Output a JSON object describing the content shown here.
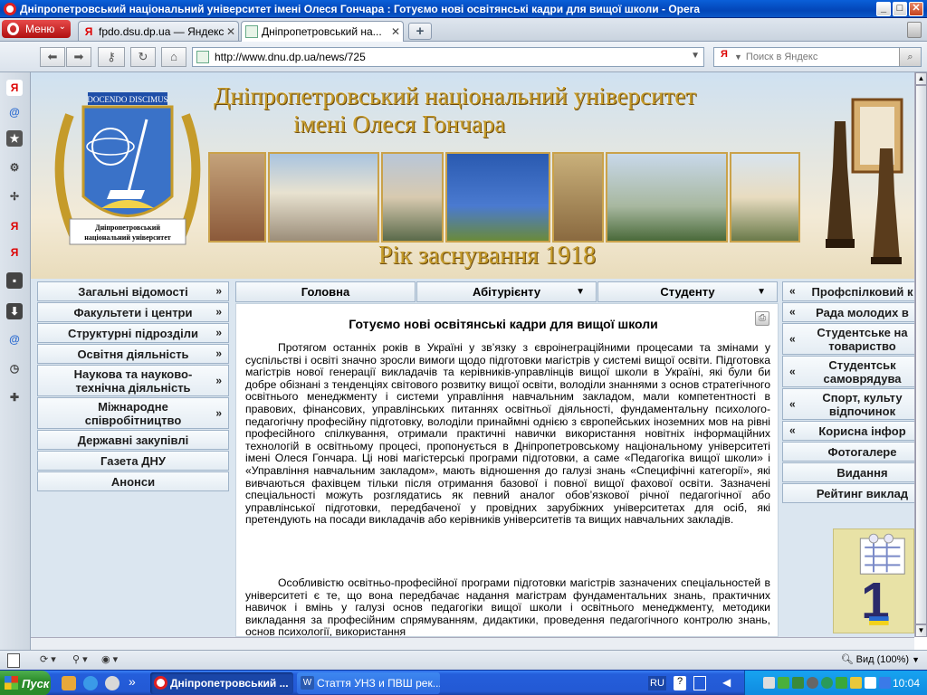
{
  "window": {
    "title": "Дніпропетровський національний університет імені Олеся Гончара : Готуємо нові освітянські кадри для вищої школи - Opera",
    "controls": {
      "minimize": "_",
      "maximize": "□",
      "close": "✕"
    }
  },
  "browser": {
    "menu_label": "Меню",
    "tabs": [
      {
        "label": "fpdo.dsu.dp.ua — Яндекс...",
        "close": "✕",
        "active": false
      },
      {
        "label": "Дніпропетровський на...",
        "close": "✕",
        "active": true
      }
    ],
    "new_tab": "+",
    "address": "http://www.dnu.dp.ua/news/725",
    "search_placeholder": "Поиск в Яндекс",
    "search_engine_glyph": "Я"
  },
  "header": {
    "title_line1": "Дніпропетровський національний університет",
    "title_line2": "імені Олеся Гончара",
    "motto": "DOCENDO DISCIMUS",
    "emblem_caption_1": "Дніпропетровський",
    "emblem_caption_2": "національний університет",
    "founded": "Рік заснування 1918"
  },
  "left_menu": [
    {
      "label": "Загальні відомості",
      "arrow": "»"
    },
    {
      "label": "Факультети і центри",
      "arrow": "»"
    },
    {
      "label": "Структурні підрозділи",
      "arrow": "»"
    },
    {
      "label": "Освітня діяльність",
      "arrow": "»"
    },
    {
      "label": "Наукова та науково-технічна діяльність",
      "arrow": "»"
    },
    {
      "label": "Міжнародне співробітництво",
      "arrow": "»"
    },
    {
      "label": "Державні закупівлі",
      "arrow": ""
    },
    {
      "label": "Газета ДНУ",
      "arrow": ""
    },
    {
      "label": "Анонси",
      "arrow": ""
    }
  ],
  "top_menu": [
    {
      "label": "Головна",
      "arrow": ""
    },
    {
      "label": "Абітурієнту",
      "arrow": "▼"
    },
    {
      "label": "Студенту",
      "arrow": "▼"
    }
  ],
  "article": {
    "title": "Готуємо нові освітянські кадри для вищої школи",
    "paragraph1": "Протягом останніх років в Україні у зв’язку з євроінеграційними процесами та змінами у суспільстві і освіті значно зросли вимоги щодо підготовки магістрів у системі вищої освіти. Підготовка магістрів нової генерації викладачів та керівників-управлінців вищої школи в Україні, які були би добре обізнані з тенденціях світового розвитку вищої освіти, володіли знаннями з основ стратегічного освітнього менеджменту і системи управління навчальним закладом, мали компетентності в правових, фінансових, управлінських питаннях освітньої діяльності, фундаментальну психолого-педагогічну професійну підготовку, володіли принаймні однією з європейських іноземних мов на рівні професійного спілкування, отримали практичні навички використання новітніх інформаційних технологій в освітньому процесі, пропонується в Дніпропетровському національному університеті імені Олеся Гончара. Ці нові магістерські програми підготовки, а саме «Педагогіка вищої школи» і «Управління навчальним закладом», мають відношення до галузі знань «Специфічні категорії», які вивчаються фахівцем тільки після отримання базової і повної вищої фахової освіти. Зазначені спеціальності можуть розглядатись як певний аналог обов’язкової річної педагогічної або управлінської підготовки, передбаченої у провідних зарубіжних університетах для осіб, які претендують на посади викладачів або керівників університетів та вищих навчальних закладів.",
    "paragraph2": "Особливістю освітньо-професійної програми підготовки магістрів зазначених спеціальностей в університеті є те, що вона передбачає надання магістрам фундаментальних знань, практичних навичок і вмінь у галузі основ педагогіки вищої школи і освітнього менеджменту, методики викладання за професійним спрямуванням, дидактики, проведення педагогічного контролю знань, основ психології, використання"
  },
  "right_menu": [
    {
      "label": "Профспілковий к",
      "arrow": "«"
    },
    {
      "label": "Рада молодих в",
      "arrow": "«"
    },
    {
      "label": "Студентське на товариство",
      "arrow": "«"
    },
    {
      "label": "Студентськ самоврядува",
      "arrow": "«"
    },
    {
      "label": "Спорт, культу відпочинок",
      "arrow": "«"
    },
    {
      "label": "Корисна інфор",
      "arrow": "«"
    },
    {
      "label": "Фотогалере",
      "arrow": ""
    },
    {
      "label": "Видання",
      "arrow": ""
    },
    {
      "label": "Рейтинг виклад",
      "arrow": ""
    }
  ],
  "banner": {
    "big_number": "1"
  },
  "status": {
    "zoom": "Вид (100%)"
  },
  "taskbar": {
    "start": "Пуск",
    "tasks": [
      {
        "label": "Дніпропетровський ...",
        "active": true
      },
      {
        "label": "Стаття УНЗ и ПВШ рек...",
        "active": false
      }
    ],
    "lang": "RU",
    "clock": "10:04",
    "more": "»"
  },
  "colors": {
    "accent_title": "#c59b2a",
    "titlebar": "#0346b8",
    "menu_border": "#9fb3c8",
    "taskbar": "#245edb"
  }
}
